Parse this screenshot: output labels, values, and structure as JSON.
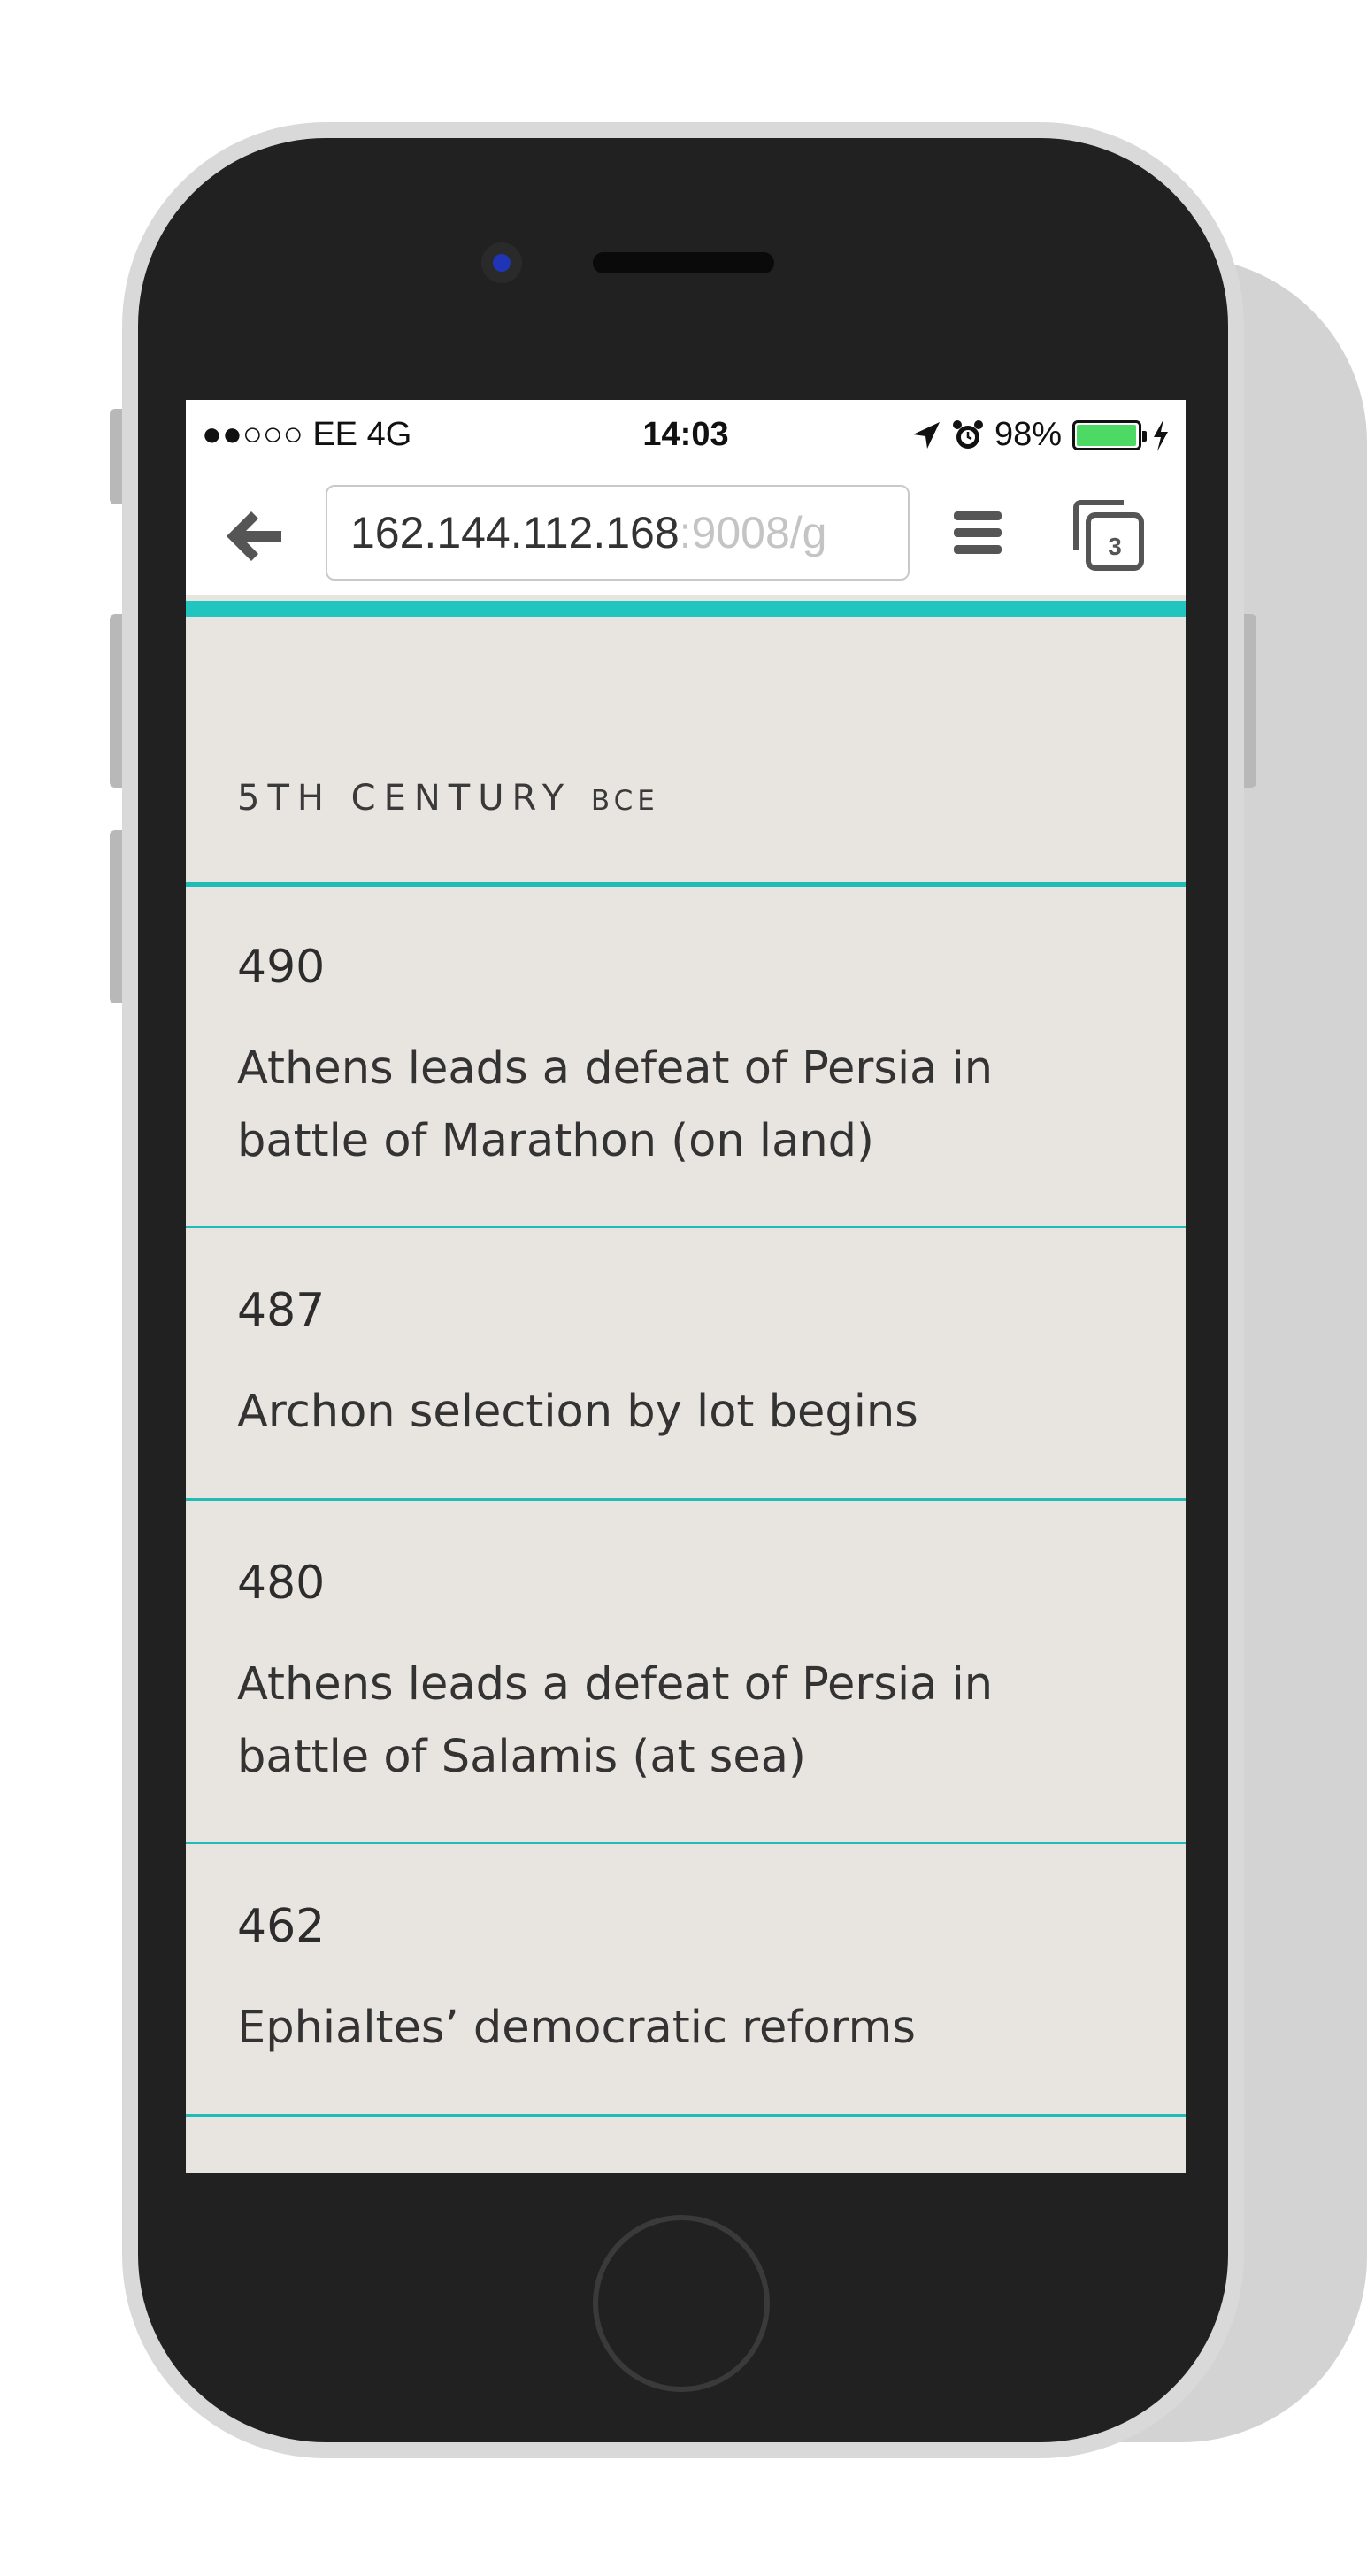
{
  "status_bar": {
    "carrier": "●●○○○ EE   4G",
    "time": "14:03",
    "location_icon": "location-arrow-icon",
    "alarm_icon": "alarm-clock-icon",
    "battery_percent": "98%",
    "battery_level": 0.98,
    "battery_color": "#4cd964",
    "charging_icon": "lightning-bolt-icon"
  },
  "browser": {
    "url_host": "162.144.112.168",
    "url_rest": ":9008/g",
    "back_icon": "back-arrow-icon",
    "menu_icon": "hamburger-menu-icon",
    "tabs_count": "3"
  },
  "accent_color": "#20c5c0",
  "timeline": {
    "heading": "5TH CENTURY",
    "heading_suffix": "BCE",
    "events": [
      {
        "year": "490",
        "text": "Athens leads a defeat of Persia in battle of Marathon (on land)"
      },
      {
        "year": "487",
        "text": "Archon selection by lot begins"
      },
      {
        "year": "480",
        "text": "Athens leads a defeat of Persia in battle of Salamis (at sea)"
      },
      {
        "year": "462",
        "text": "Ephialtes’ democratic reforms"
      }
    ]
  }
}
